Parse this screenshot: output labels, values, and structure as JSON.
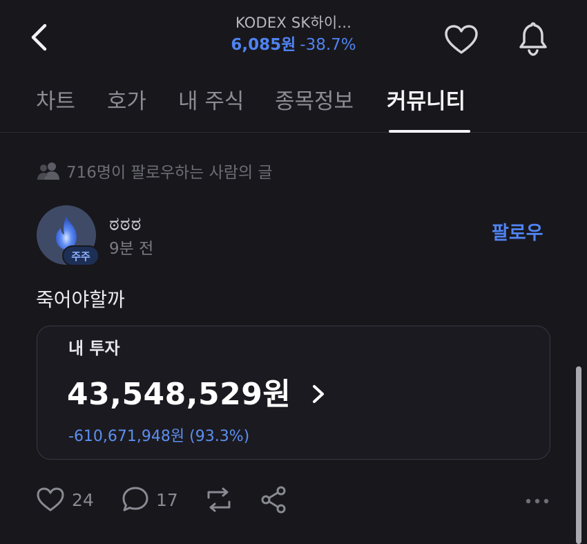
{
  "header": {
    "stock_name": "KODEX SK하이...",
    "price": "6,085원",
    "change_pct": "-38.7%",
    "back_icon": "chevron-left-icon",
    "favorite_icon": "heart-icon",
    "alert_icon": "bell-icon"
  },
  "tabs": [
    {
      "label": "차트"
    },
    {
      "label": "호가"
    },
    {
      "label": "내 주식"
    },
    {
      "label": "종목정보"
    },
    {
      "label": "커뮤니티",
      "active": true
    }
  ],
  "community": {
    "follow_context": "716명이 팔로우하는 사람의 글",
    "post": {
      "username": "ಠಠಠ",
      "time": "9분 전",
      "badge": "주주",
      "follow_label": "팔로우",
      "body": "죽어야할까",
      "investment": {
        "title": "내 투자",
        "amount": "43,548,529원",
        "change": "-610,671,948원 (93.3%)"
      },
      "actions": {
        "likes": "24",
        "comments": "17"
      }
    }
  },
  "colors": {
    "background": "#18171c",
    "accent": "#4f83f1",
    "text": "#ececf0",
    "muted": "#8c8c94"
  }
}
